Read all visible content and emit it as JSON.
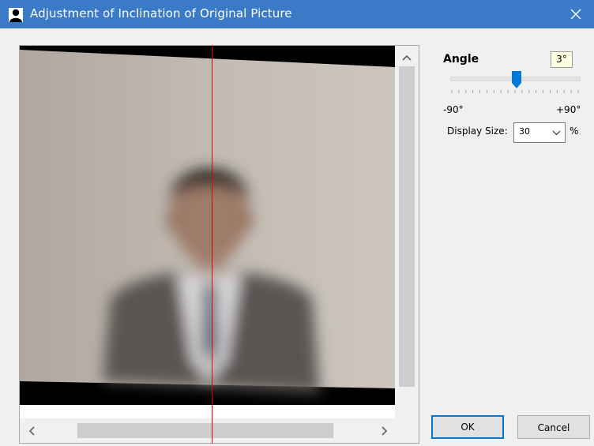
{
  "window": {
    "title": "Adjustment of Inclination of Original Picture",
    "close_glyph": "✕",
    "title_icon": "person-icon",
    "titlebar_color": "#3b7ac6"
  },
  "controls": {
    "angle_label": "Angle",
    "angle_value": "3°",
    "slider": {
      "min": -90,
      "max": 90,
      "value": 3
    },
    "min_label": "-90°",
    "max_label": "+90°",
    "display_size_label": "Display Size:",
    "display_size_value": "30",
    "percent_label": "%"
  },
  "buttons": {
    "ok_label": "OK",
    "cancel_label": "Cancel"
  },
  "colors": {
    "accent": "#0078d7",
    "guide_line": "#e00000"
  }
}
